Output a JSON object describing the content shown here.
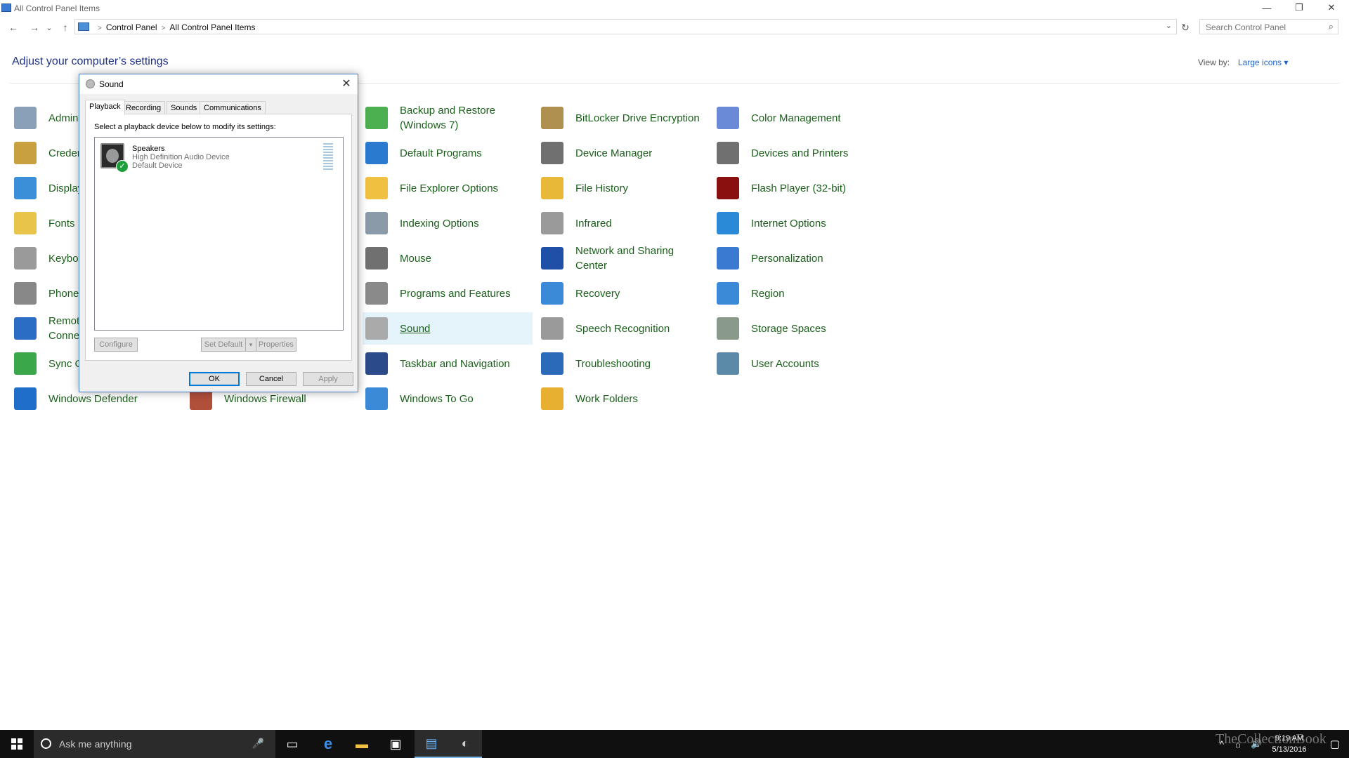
{
  "window": {
    "title": "All Control Panel Items",
    "minimize": "—",
    "restore": "❐",
    "close": "✕"
  },
  "nav": {
    "back": "←",
    "forward": "→",
    "recent": "⌄",
    "up": "↑",
    "breadcrumbs": [
      "Control Panel",
      "All Control Panel Items"
    ],
    "refresh": "↻",
    "search_placeholder": "Search Control Panel"
  },
  "header": {
    "title": "Adjust your computer’s settings",
    "view_by_label": "View by:",
    "view_by_value": "Large icons ▾"
  },
  "items": [
    {
      "label": "Administrative Tools",
      "icon": "admin-tools-icon",
      "color": "#8aa0b8"
    },
    {
      "label": "Credential Manager",
      "icon": "credential-icon",
      "color": "#c8a040"
    },
    {
      "label": "Display",
      "icon": "display-icon",
      "color": "#3b8fd8"
    },
    {
      "label": "Fonts",
      "icon": "fonts-icon",
      "color": "#e8c44a"
    },
    {
      "label": "Keyboard",
      "icon": "keyboard-icon",
      "color": "#9a9a9a"
    },
    {
      "label": "Phone and Modem",
      "icon": "phone-icon",
      "color": "#888888"
    },
    {
      "label": "RemoteApp and Desktop Connections",
      "icon": "remote-icon",
      "color": "#2b6cc4"
    },
    {
      "label": "Sync Center",
      "icon": "sync-icon",
      "color": "#3aa84a"
    },
    {
      "label": "Windows Defender",
      "icon": "defender-icon",
      "color": "#1f6fc8"
    },
    {
      "label": "Windows Firewall",
      "icon": "firewall-icon",
      "color": "#b0503a"
    },
    {
      "label": "Backup and Restore\n(Windows 7)",
      "icon": "backup-icon",
      "color": "#4caf50"
    },
    {
      "label": "Default Programs",
      "icon": "default-programs-icon",
      "color": "#2a7ad0"
    },
    {
      "label": "File Explorer Options",
      "icon": "folder-options-icon",
      "color": "#f0c040"
    },
    {
      "label": "Indexing Options",
      "icon": "indexing-icon",
      "color": "#8a9aa8"
    },
    {
      "label": "Mouse",
      "icon": "mouse-icon",
      "color": "#707070"
    },
    {
      "label": "Programs and Features",
      "icon": "programs-icon",
      "color": "#8a8a8a"
    },
    {
      "label": "Sound",
      "icon": "sound-icon",
      "color": "#aaaaaa"
    },
    {
      "label": "Taskbar and Navigation",
      "icon": "taskbar-icon",
      "color": "#2a4a8a"
    },
    {
      "label": "Windows To Go",
      "icon": "windows-to-go-icon",
      "color": "#3a8ad8"
    },
    {
      "label": "BitLocker Drive Encryption",
      "icon": "bitlocker-icon",
      "color": "#b09050"
    },
    {
      "label": "Device Manager",
      "icon": "device-manager-icon",
      "color": "#707070"
    },
    {
      "label": "File History",
      "icon": "file-history-icon",
      "color": "#e8b838"
    },
    {
      "label": "Infrared",
      "icon": "infrared-icon",
      "color": "#9a9a9a"
    },
    {
      "label": "Network and Sharing\nCenter",
      "icon": "network-icon",
      "color": "#1e50a8"
    },
    {
      "label": "Recovery",
      "icon": "recovery-icon",
      "color": "#3a8ad8"
    },
    {
      "label": "Speech Recognition",
      "icon": "microphone-icon",
      "color": "#9a9a9a"
    },
    {
      "label": "Troubleshooting",
      "icon": "troubleshooting-icon",
      "color": "#2a6ab8"
    },
    {
      "label": "Work Folders",
      "icon": "work-folders-icon",
      "color": "#e8b030"
    },
    {
      "label": "Color Management",
      "icon": "color-management-icon",
      "color": "#6a8ad8"
    },
    {
      "label": "Devices and Printers",
      "icon": "printer-icon",
      "color": "#707070"
    },
    {
      "label": "Flash Player (32-bit)",
      "icon": "flash-icon",
      "color": "#8a1010"
    },
    {
      "label": "Internet Options",
      "icon": "internet-options-icon",
      "color": "#2a8ad8"
    },
    {
      "label": "Personalization",
      "icon": "personalization-icon",
      "color": "#3a7ad0"
    },
    {
      "label": "Region",
      "icon": "region-icon",
      "color": "#3a8ad8"
    },
    {
      "label": "Storage Spaces",
      "icon": "storage-icon",
      "color": "#8a9a8a"
    },
    {
      "label": "User Accounts",
      "icon": "user-accounts-icon",
      "color": "#5a8aa8"
    }
  ],
  "dialog": {
    "title": "Sound",
    "close": "✕",
    "tabs": [
      "Playback",
      "Recording",
      "Sounds",
      "Communications"
    ],
    "instruction": "Select a playback device below to modify its settings:",
    "device": {
      "name": "Speakers",
      "driver": "High Definition Audio Device",
      "status": "Default Device",
      "check": "✓"
    },
    "configure": "Configure",
    "set_default": "Set Default",
    "set_default_arrow": "▾",
    "properties": "Properties",
    "ok": "OK",
    "cancel": "Cancel",
    "apply": "Apply"
  },
  "taskbar": {
    "search_placeholder": "Ask me anything",
    "mic": "🎤",
    "task_view": "▭",
    "edge": "e",
    "explorer": "▬",
    "store": "▣",
    "control_panel": "▤",
    "sound_app": "◐",
    "time": "9:19 AM",
    "date": "5/13/2016",
    "tray_up": "^",
    "network": "⌂",
    "volume": "🔊",
    "notifications": "▢",
    "watermark": "TheCollectionBook"
  }
}
